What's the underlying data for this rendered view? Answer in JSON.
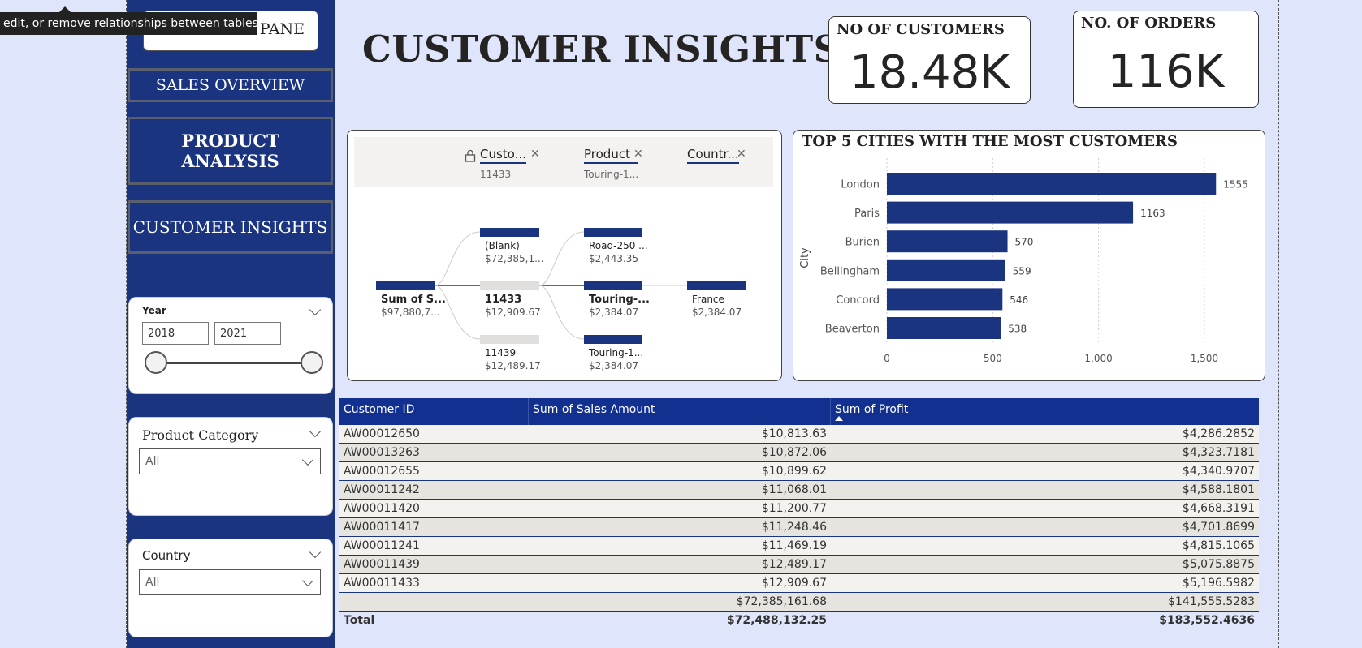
{
  "tooltip": "edit, or remove relationships between tables.",
  "nav": {
    "top_label": "PANE",
    "sales_overview": "SALES OVERVIEW",
    "product_analysis": "PRODUCT ANALYSIS",
    "customer_insights": "CUSTOMER INSIGHTS"
  },
  "slicers": {
    "year": {
      "title": "Year",
      "from": "2018",
      "to": "2021"
    },
    "product_category": {
      "title": "Product Category",
      "value": "All"
    },
    "country": {
      "title": "Country",
      "value": "All"
    }
  },
  "page_title": "CUSTOMER INSIGHTS",
  "cards": {
    "customers": {
      "label": "NO OF CUSTOMERS",
      "value": "18.48K"
    },
    "orders": {
      "label": "NO. OF ORDERS",
      "value": "116K"
    }
  },
  "decomp_tree": {
    "columns": [
      {
        "label": "Custo...",
        "sub": "11433"
      },
      {
        "label": "Product",
        "sub": "Touring-1..."
      },
      {
        "label": "Countr...",
        "sub": ""
      }
    ],
    "root": {
      "label": "Sum of S...",
      "value": "$97,880,7..."
    },
    "level1": [
      {
        "label": "(Blank)",
        "value": "$72,385,1..."
      },
      {
        "label": "11433",
        "value": "$12,909.67"
      },
      {
        "label": "11439",
        "value": "$12,489.17"
      }
    ],
    "level2": [
      {
        "label": "Road-250 ...",
        "value": "$2,443.35"
      },
      {
        "label": "Touring-...",
        "value": "$2,384.07"
      },
      {
        "label": "Touring-1...",
        "value": "$2,384.07"
      }
    ],
    "level3": [
      {
        "label": "France",
        "value": "$2,384.07"
      }
    ]
  },
  "chart_data": {
    "type": "bar",
    "title": "TOP 5 CITIES WITH THE MOST CUSTOMERS",
    "ylabel": "City",
    "categories": [
      "London",
      "Paris",
      "Burien",
      "Bellingham",
      "Concord",
      "Beaverton"
    ],
    "values": [
      1555,
      1163,
      570,
      559,
      546,
      538
    ],
    "xticks": [
      "0",
      "500",
      "1,000",
      "1,500"
    ],
    "xlim": [
      0,
      1650
    ],
    "color": "#1a3480"
  },
  "table": {
    "headers": [
      "Customer ID",
      "Sum of Sales Amount",
      "Sum of Profit"
    ],
    "rows": [
      [
        "AW00012650",
        "$10,813.63",
        "$4,286.2852"
      ],
      [
        "AW00013263",
        "$10,872.06",
        "$4,323.7181"
      ],
      [
        "AW00012655",
        "$10,899.62",
        "$4,340.9707"
      ],
      [
        "AW00011242",
        "$11,068.01",
        "$4,588.1801"
      ],
      [
        "AW00011420",
        "$11,200.77",
        "$4,668.3191"
      ],
      [
        "AW00011417",
        "$11,248.46",
        "$4,701.8699"
      ],
      [
        "AW00011241",
        "$11,469.19",
        "$4,815.1065"
      ],
      [
        "AW00011439",
        "$12,489.17",
        "$5,075.8875"
      ],
      [
        "AW00011433",
        "$12,909.67",
        "$5,196.5982"
      ],
      [
        "",
        "$72,385,161.68",
        "$141,555.5283"
      ]
    ],
    "total": {
      "label": "Total",
      "sales": "$72,488,132.25",
      "profit": "$183,552.4636"
    }
  }
}
